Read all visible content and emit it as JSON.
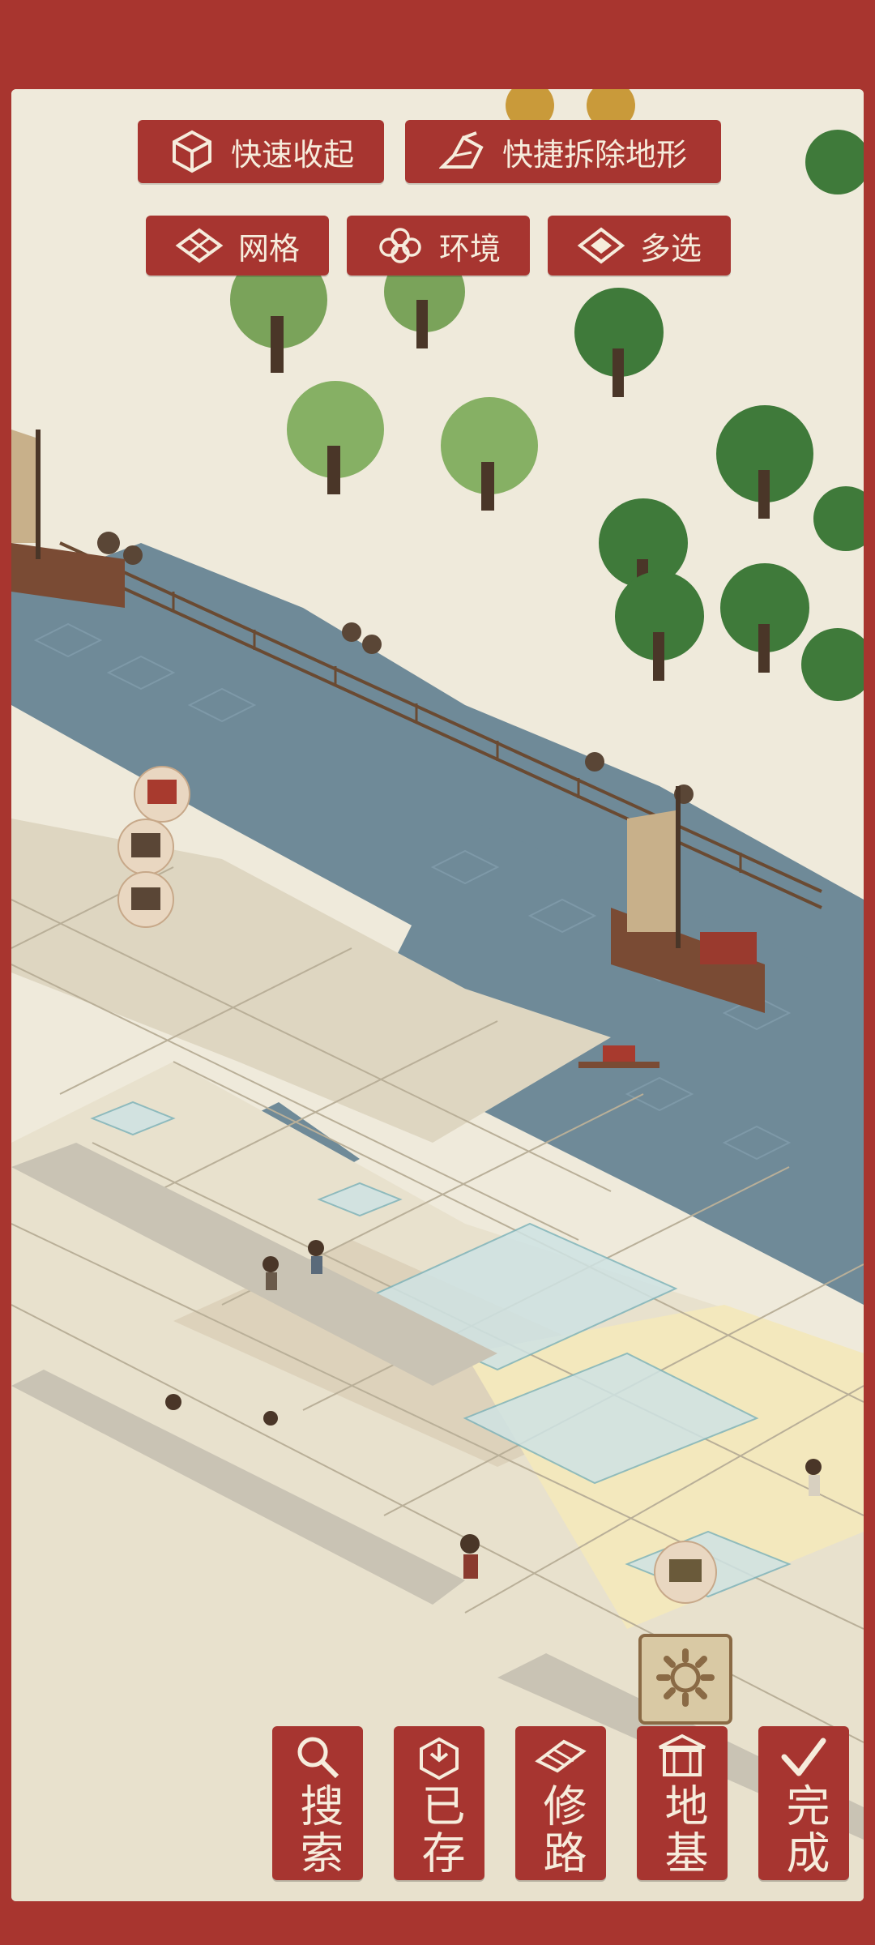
{
  "toolbar_top": {
    "collapse": {
      "label": "快速收起",
      "icon": "box-icon"
    },
    "remove_terrain": {
      "label": "快捷拆除地形",
      "icon": "shovel-icon"
    }
  },
  "toolbar_second": {
    "grid": {
      "label": "网格",
      "icon": "grid-icon"
    },
    "environment": {
      "label": "环境",
      "icon": "flower-icon"
    },
    "multiselect": {
      "label": "多选",
      "icon": "multiselect-icon"
    }
  },
  "bottom_bar": {
    "search": {
      "label": "搜索",
      "icon": "search-icon"
    },
    "saved": {
      "label": "已存",
      "icon": "storage-box-icon"
    },
    "road": {
      "label": "修路",
      "icon": "road-icon"
    },
    "foundation": {
      "label": "地基",
      "icon": "foundation-icon"
    },
    "done": {
      "label": "完成",
      "icon": "checkmark-icon"
    }
  },
  "colors": {
    "frame": "#a8352f",
    "paper": "#efeadb",
    "water": "#6d8796",
    "button": "#a73530",
    "button_text": "#f6ecdc"
  }
}
